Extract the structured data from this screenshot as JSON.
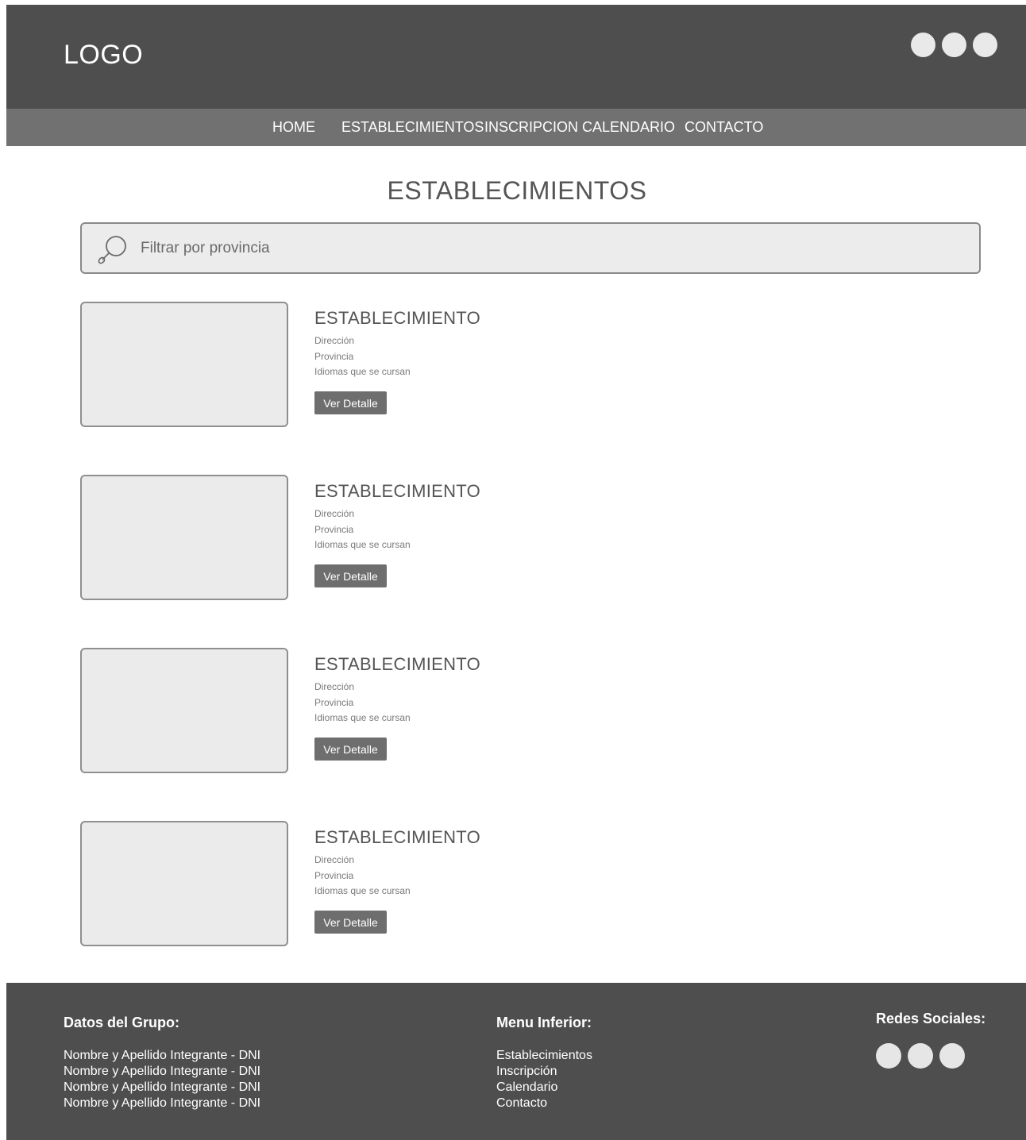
{
  "header": {
    "logo": "LOGO"
  },
  "nav": {
    "items": [
      "HOME",
      "ESTABLECIMIENTOS",
      "INSCRIPCION",
      "CALENDARIO",
      "CONTACTO"
    ]
  },
  "main": {
    "title": "ESTABLECIMIENTOS",
    "search": {
      "placeholder": "Filtrar por provincia"
    },
    "cards": [
      {
        "title": "ESTABLECIMIENTO",
        "address": "Dirección",
        "province": "Provincia",
        "languages": "Idiomas que se cursan",
        "button": "Ver Detalle"
      },
      {
        "title": "ESTABLECIMIENTO",
        "address": "Dirección",
        "province": "Provincia",
        "languages": "Idiomas que se cursan",
        "button": "Ver Detalle"
      },
      {
        "title": "ESTABLECIMIENTO",
        "address": "Dirección",
        "province": "Provincia",
        "languages": "Idiomas que se cursan",
        "button": "Ver Detalle"
      },
      {
        "title": "ESTABLECIMIENTO",
        "address": "Dirección",
        "province": "Provincia",
        "languages": "Idiomas que se cursan",
        "button": "Ver Detalle"
      }
    ]
  },
  "footer": {
    "group": {
      "heading": "Datos del Grupo:",
      "members": [
        "Nombre y Apellido Integrante - DNI",
        "Nombre y Apellido Integrante - DNI",
        "Nombre y Apellido Integrante - DNI",
        "Nombre y Apellido Integrante - DNI"
      ]
    },
    "menu": {
      "heading": "Menu Inferior:",
      "links": [
        "Establecimientos",
        "Inscripción",
        "Calendario",
        "Contacto"
      ]
    },
    "social": {
      "heading": "Redes Sociales:"
    }
  },
  "colors": {
    "header_bg": "#4e4e4e",
    "nav_bg": "#717171",
    "button_bg": "#6e6e6e",
    "placeholder_fill": "#ebebeb"
  }
}
